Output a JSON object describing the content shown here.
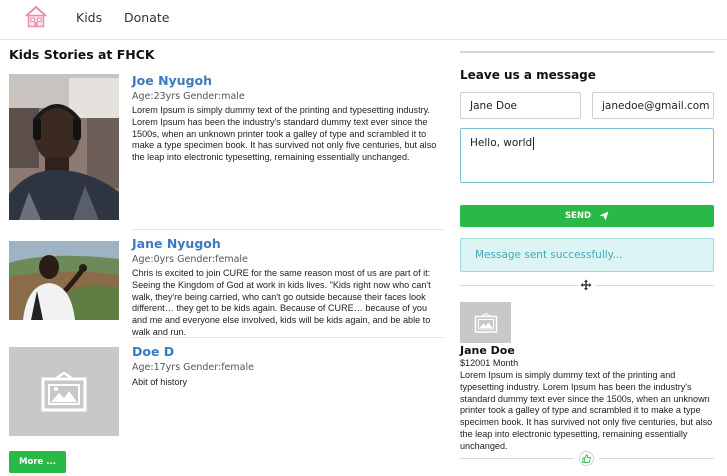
{
  "nav": {
    "home_icon": "house-icon",
    "links": [
      "Kids",
      "Donate"
    ]
  },
  "stories_section": {
    "title": "Kids Stories at FHCK",
    "stories": [
      {
        "name": "Joe Nyugoh",
        "meta": "Age:23yrs Gender:male",
        "text": "Lorem Ipsum is simply dummy text of the printing and typesetting industry. Lorem Ipsum has been the industry's standard dummy text ever since the 1500s, when an unknown printer took a galley of type and scrambled it to make a type specimen book. It has survived not only five centuries, but also the leap into electronic typesetting, remaining essentially unchanged."
      },
      {
        "name": "Jane Nyugoh",
        "meta": "Age:0yrs Gender:female",
        "text": "Chris is excited to join CURE for the same reason most of us are part of it: Seeing the Kingdom of God at work in kids lives. \"Kids right now who can't walk, they're being carried, who can't go outside because their faces look different… they get to be kids again. Because of CURE… because of you and me and everyone else involved, kids will be kids again, and be able to walk and run."
      },
      {
        "name": "Doe D",
        "meta": "Age:17yrs Gender:female",
        "text": "Abit of history"
      }
    ],
    "more_label": "More ..."
  },
  "message_form": {
    "title": "Leave us a message",
    "name_value": "Jane Doe",
    "email_value": "janedoe@gmail.com",
    "message_value": "Hello, world",
    "send_label": "SEND",
    "send_icon": "paper-plane-icon",
    "success_text": "Message sent successfully..."
  },
  "donor": {
    "name": "Jane Doe",
    "amount": "$12001 Month",
    "text": "Lorem Ipsum is simply dummy text of the printing and typesetting industry. Lorem Ipsum has been the industry's standard dummy text ever since the 1500s, when an unknown printer took a galley of type and scrambled it to make a type specimen book. It has survived not only five centuries, but also the leap into electronic typesetting, remaining essentially unchanged.",
    "like_icon": "thumbs-up-icon"
  },
  "colors": {
    "accent_green": "#28b947",
    "link_blue": "#3b7bbf",
    "alert_bg": "#dcf4f4",
    "alert_text": "#3fa9b5"
  }
}
